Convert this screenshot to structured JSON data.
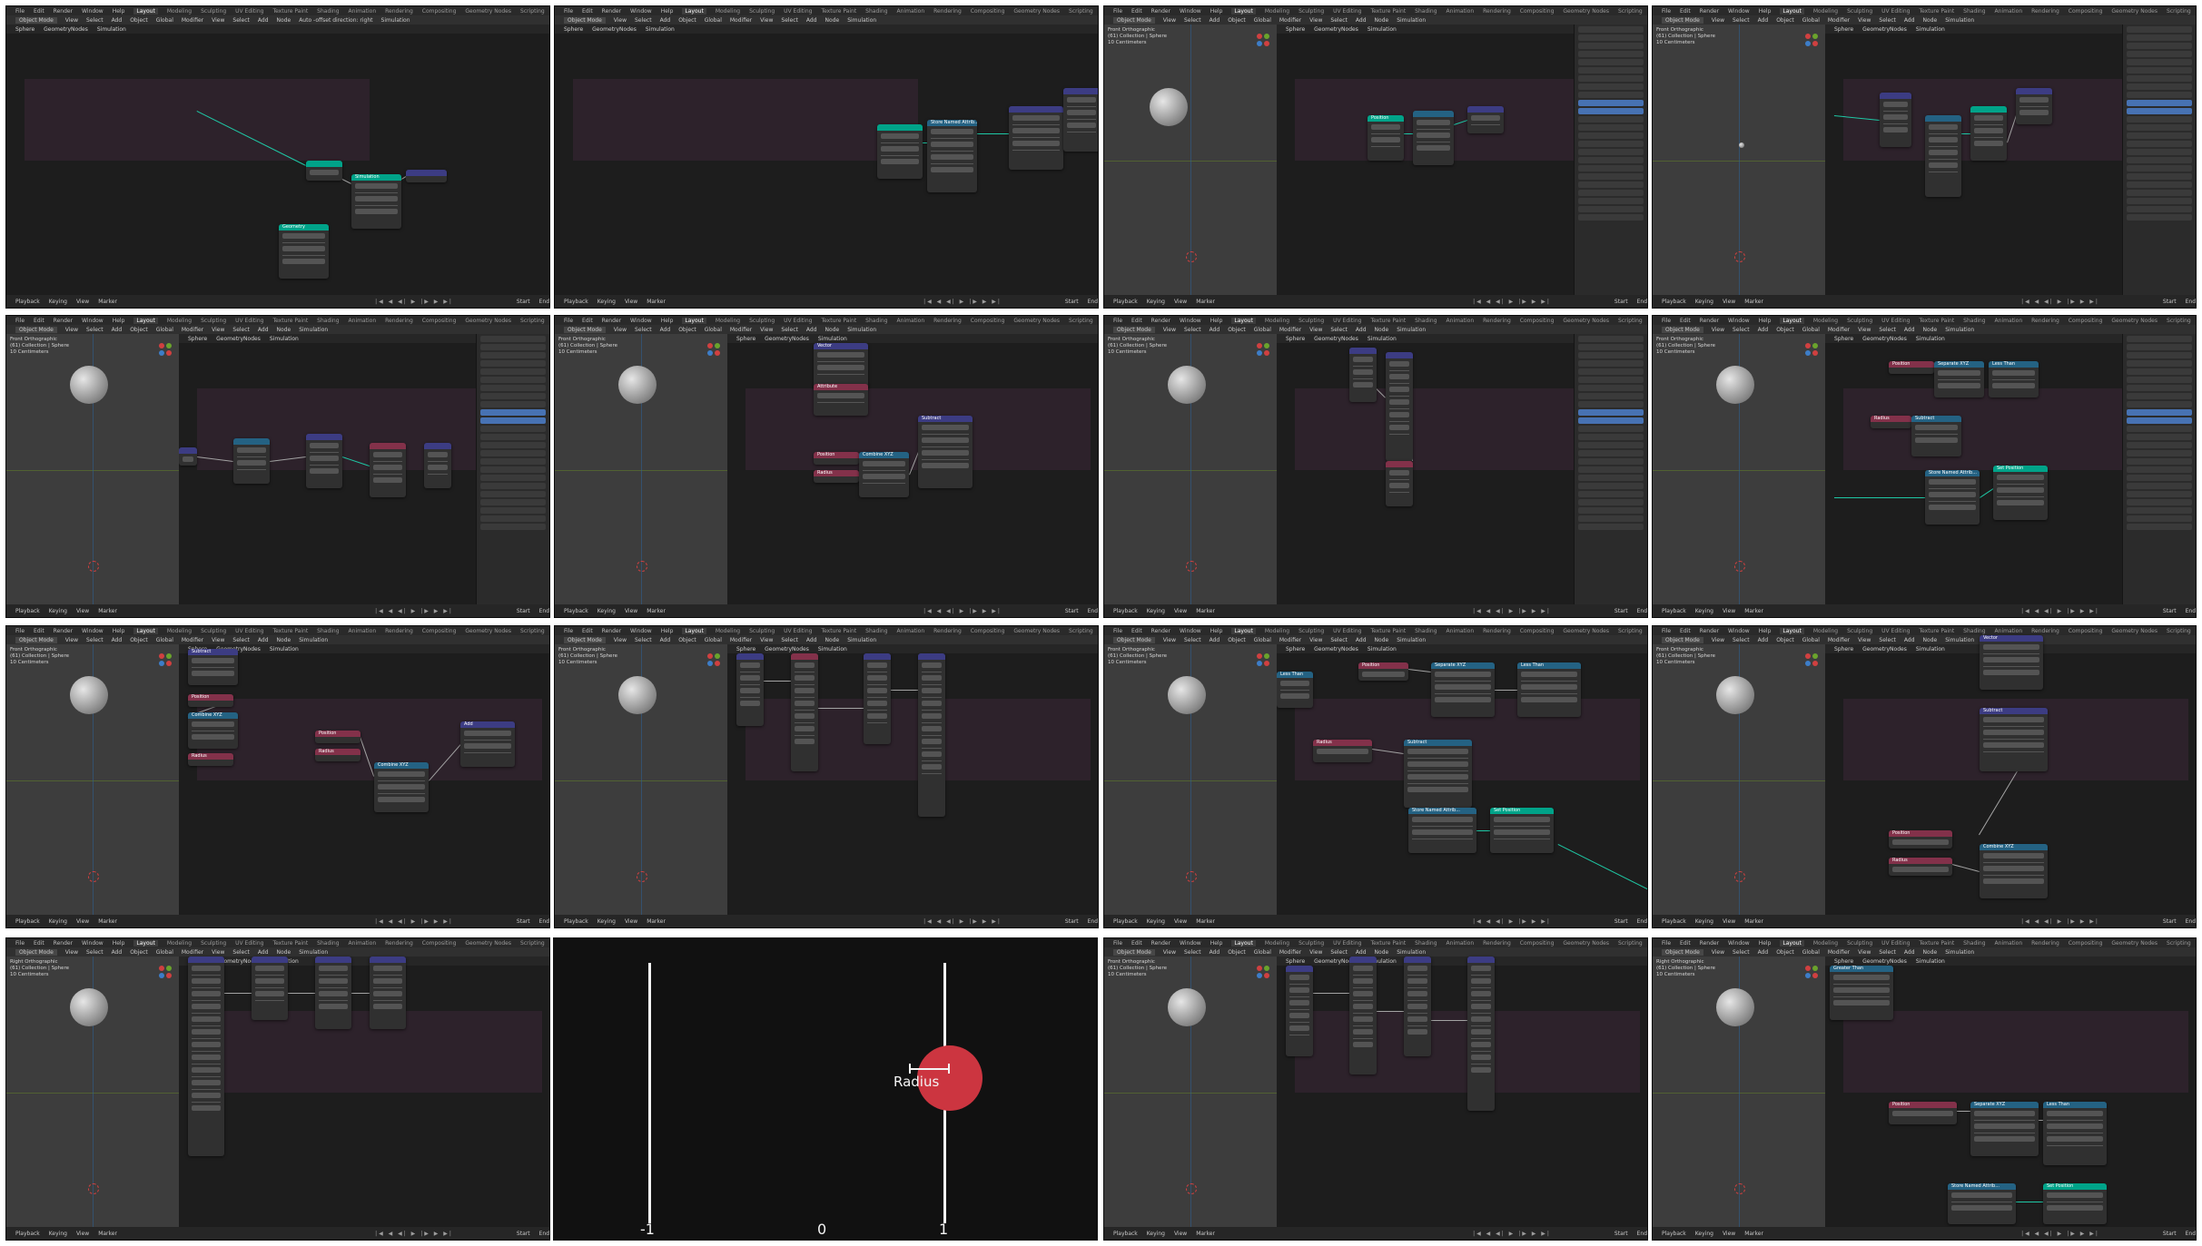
{
  "menu": [
    "File",
    "Edit",
    "Render",
    "Window",
    "Help"
  ],
  "workspaces": [
    "Layout",
    "Modeling",
    "Sculpting",
    "UV Editing",
    "Texture Paint",
    "Shading",
    "Animation",
    "Rendering",
    "Compositing",
    "Geometry Nodes",
    "Scripting"
  ],
  "scene_label": "Scene",
  "toolbar": {
    "mode": "Object Mode",
    "items": [
      "View",
      "Select",
      "Add",
      "Object",
      "Global"
    ],
    "editor_items": [
      "Modifier",
      "View",
      "Select",
      "Add",
      "Node"
    ],
    "simulation": "Simulation"
  },
  "snap_hint": "Auto -offset direction: right",
  "viewport_info": {
    "front": [
      "Front Orthographic",
      "(61) Collection | Sphere",
      "10 Centimeters"
    ],
    "right": [
      "Right Orthographic",
      "(61) Collection | Sphere",
      "10 Centimeters"
    ]
  },
  "breadcrumb": [
    "Sphere",
    "GeometryNodes",
    "Simulation"
  ],
  "timeline": {
    "items": [
      "Playback",
      "Keying",
      "View",
      "Marker"
    ],
    "start_label": "Start",
    "end_label": "End",
    "controls": "|◀ ◀ ◀| ▶ |▶ ▶ ▶|"
  },
  "node_labels": {
    "position": "Position",
    "radius": "Radius",
    "subtract": "Subtract",
    "combine_xyz": "Combine XYZ",
    "separate_xyz": "Separate XYZ",
    "less_than": "Less Than",
    "greater_than": "Greater Than",
    "store_named": "Store Named Attrib...",
    "set_position": "Set Position",
    "simulation": "Simulation",
    "geometry": "Geometry",
    "add": "Add",
    "multiply": "Multiply",
    "vector": "Vector",
    "value": "Value",
    "result": "Result",
    "float": "Float",
    "clamp": "Clamp",
    "selection": "Selection",
    "point": "Point",
    "velocity": "Velocity",
    "name": "Name",
    "attribute": "Attribute",
    "exists": "Exists",
    "value_0": "0.000",
    "value_1": "1.000",
    "value_neg1": "-1.000"
  },
  "diagram": {
    "label_radius": "Radius",
    "tick_left": "-1",
    "tick_mid": "0",
    "tick_right": "1",
    "circle_color": "#cc3540"
  },
  "colors": {
    "node_geometry": "#00a389",
    "node_input": "#83314a",
    "node_vector": "#3c3c83",
    "node_converter": "#246283",
    "link_geometry": "#1ec8a5",
    "link_default": "#a3a3a3"
  }
}
